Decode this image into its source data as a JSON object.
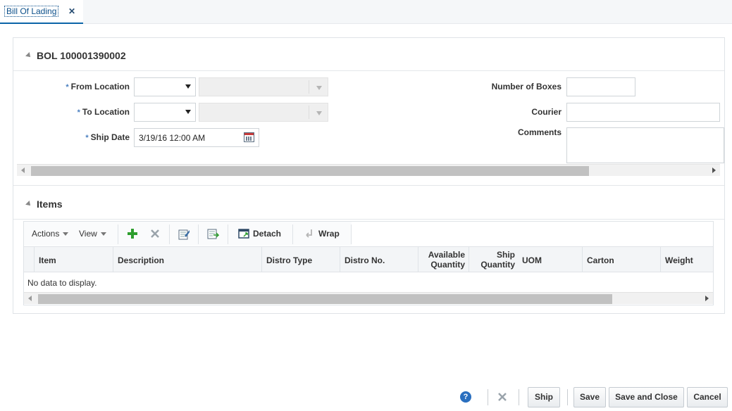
{
  "tab": {
    "title": "Bill Of Lading",
    "close": "✕"
  },
  "bol": {
    "header": "BOL 100001390002",
    "required_mark": "*",
    "from_location_label": "From Location",
    "to_location_label": "To Location",
    "ship_date_label": "Ship Date",
    "ship_date_value": "3/19/16 12:00 AM",
    "number_of_boxes_label": "Number of Boxes",
    "courier_label": "Courier",
    "comments_label": "Comments"
  },
  "items": {
    "header": "Items",
    "toolbar": {
      "actions": "Actions",
      "view": "View",
      "detach": "Detach",
      "wrap": "Wrap"
    },
    "columns": [
      "Item",
      "Description",
      "Distro Type",
      "Distro No.",
      "Available Quantity",
      "Ship Quantity",
      "UOM",
      "Carton",
      "Weight"
    ],
    "empty_message": "No data to display."
  },
  "footer": {
    "help": "?",
    "ship": "Ship",
    "save": "Save",
    "save_and_close": "Save and Close",
    "cancel": "Cancel"
  },
  "colors": {
    "accent": "#0b64a8",
    "required": "#4a7fc0",
    "add_icon": "#2e9e2e"
  }
}
